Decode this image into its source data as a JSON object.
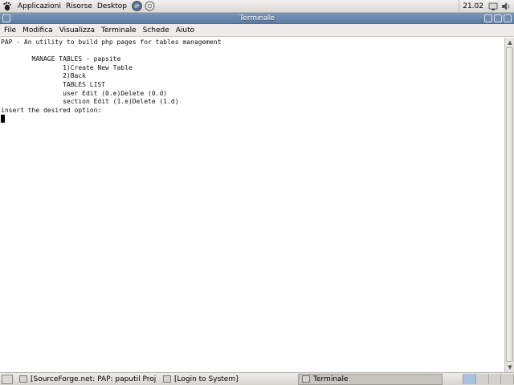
{
  "top_panel": {
    "menus": [
      "Applicazioni",
      "Risorse",
      "Desktop"
    ],
    "clock": "21.02"
  },
  "window": {
    "title": "Terminale",
    "menus": [
      "File",
      "Modifica",
      "Visualizza",
      "Terminale",
      "Schede",
      "Aiuto"
    ]
  },
  "terminal": {
    "lines": [
      "PAP - An utility to build php pages for tables management",
      "",
      "        MANAGE TABLES - papsite",
      "                1)Create New Table",
      "                2)Back",
      "                TABLES LIST",
      "                user Edit (0.e)Delete (0.d)",
      "                section Edit (1.e)Delete (1.d)",
      "insert the desired option:"
    ]
  },
  "taskbar": {
    "tasks": [
      {
        "label": "[SourceForge.net: PAP: paputil Project:...",
        "active": false
      },
      {
        "label": "[Login to System]",
        "active": false
      },
      {
        "label": "Terminale",
        "active": true
      }
    ]
  },
  "colors": {
    "titlebar": "#5c7aa1",
    "terminal_bg": "#ffffff",
    "terminal_fg": "#111111"
  },
  "icons": {
    "top_panel": [
      "gnome-foot-icon",
      "web-browser-icon",
      "help-lifesaver-icon",
      "network-icon",
      "volume-icon"
    ],
    "window": [
      "window-menu-icon",
      "minimize-icon",
      "maximize-icon",
      "close-icon"
    ]
  }
}
